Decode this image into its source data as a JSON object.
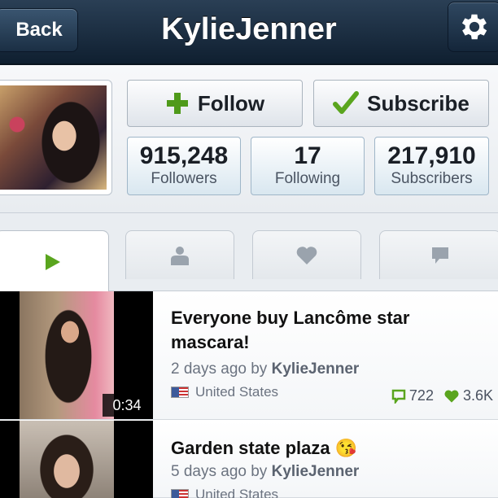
{
  "header": {
    "back_label": "Back",
    "title": "KylieJenner"
  },
  "profile": {
    "follow_label": "Follow",
    "subscribe_label": "Subscribe",
    "stats": {
      "followers": {
        "value": "915,248",
        "label": "Followers"
      },
      "following": {
        "value": "17",
        "label": "Following"
      },
      "subscribers": {
        "value": "217,910",
        "label": "Subscribers"
      }
    }
  },
  "tabs": [
    {
      "icon": "play-icon",
      "active": true
    },
    {
      "icon": "person-icon",
      "active": false
    },
    {
      "icon": "heart-icon",
      "active": false
    },
    {
      "icon": "comment-icon",
      "active": false
    }
  ],
  "feed": {
    "items": [
      {
        "title": "Everyone buy Lancôme star mascara!",
        "age": "2 days ago by",
        "author": "KylieJenner",
        "country": "United States",
        "duration": "0:34",
        "comments": "722",
        "likes": "3.6K"
      },
      {
        "title": "Garden state plaza 😘",
        "age": "5 days ago by",
        "author": "KylieJenner",
        "country": "United States"
      }
    ]
  },
  "colors": {
    "accent_green": "#5aa51e",
    "header_bg": "#1b2f44"
  }
}
